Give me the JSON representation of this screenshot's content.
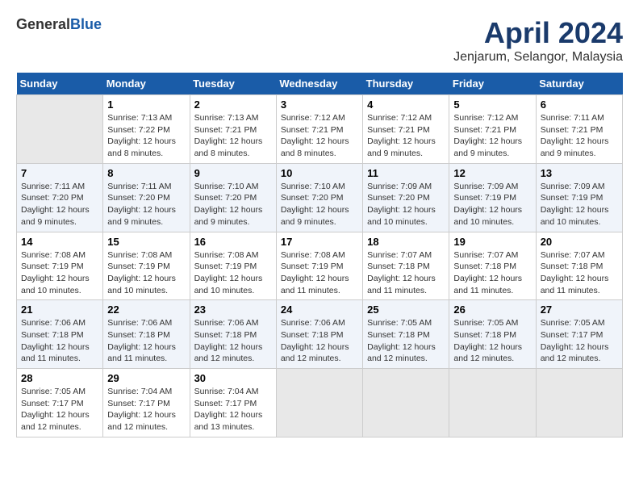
{
  "header": {
    "logo_general": "General",
    "logo_blue": "Blue",
    "title": "April 2024",
    "subtitle": "Jenjarum, Selangor, Malaysia"
  },
  "weekdays": [
    "Sunday",
    "Monday",
    "Tuesday",
    "Wednesday",
    "Thursday",
    "Friday",
    "Saturday"
  ],
  "weeks": [
    [
      {
        "day": "",
        "info": ""
      },
      {
        "day": "1",
        "info": "Sunrise: 7:13 AM\nSunset: 7:22 PM\nDaylight: 12 hours\nand 8 minutes."
      },
      {
        "day": "2",
        "info": "Sunrise: 7:13 AM\nSunset: 7:21 PM\nDaylight: 12 hours\nand 8 minutes."
      },
      {
        "day": "3",
        "info": "Sunrise: 7:12 AM\nSunset: 7:21 PM\nDaylight: 12 hours\nand 8 minutes."
      },
      {
        "day": "4",
        "info": "Sunrise: 7:12 AM\nSunset: 7:21 PM\nDaylight: 12 hours\nand 9 minutes."
      },
      {
        "day": "5",
        "info": "Sunrise: 7:12 AM\nSunset: 7:21 PM\nDaylight: 12 hours\nand 9 minutes."
      },
      {
        "day": "6",
        "info": "Sunrise: 7:11 AM\nSunset: 7:21 PM\nDaylight: 12 hours\nand 9 minutes."
      }
    ],
    [
      {
        "day": "7",
        "info": "Sunrise: 7:11 AM\nSunset: 7:20 PM\nDaylight: 12 hours\nand 9 minutes."
      },
      {
        "day": "8",
        "info": "Sunrise: 7:11 AM\nSunset: 7:20 PM\nDaylight: 12 hours\nand 9 minutes."
      },
      {
        "day": "9",
        "info": "Sunrise: 7:10 AM\nSunset: 7:20 PM\nDaylight: 12 hours\nand 9 minutes."
      },
      {
        "day": "10",
        "info": "Sunrise: 7:10 AM\nSunset: 7:20 PM\nDaylight: 12 hours\nand 9 minutes."
      },
      {
        "day": "11",
        "info": "Sunrise: 7:09 AM\nSunset: 7:20 PM\nDaylight: 12 hours\nand 10 minutes."
      },
      {
        "day": "12",
        "info": "Sunrise: 7:09 AM\nSunset: 7:19 PM\nDaylight: 12 hours\nand 10 minutes."
      },
      {
        "day": "13",
        "info": "Sunrise: 7:09 AM\nSunset: 7:19 PM\nDaylight: 12 hours\nand 10 minutes."
      }
    ],
    [
      {
        "day": "14",
        "info": "Sunrise: 7:08 AM\nSunset: 7:19 PM\nDaylight: 12 hours\nand 10 minutes."
      },
      {
        "day": "15",
        "info": "Sunrise: 7:08 AM\nSunset: 7:19 PM\nDaylight: 12 hours\nand 10 minutes."
      },
      {
        "day": "16",
        "info": "Sunrise: 7:08 AM\nSunset: 7:19 PM\nDaylight: 12 hours\nand 10 minutes."
      },
      {
        "day": "17",
        "info": "Sunrise: 7:08 AM\nSunset: 7:19 PM\nDaylight: 12 hours\nand 11 minutes."
      },
      {
        "day": "18",
        "info": "Sunrise: 7:07 AM\nSunset: 7:18 PM\nDaylight: 12 hours\nand 11 minutes."
      },
      {
        "day": "19",
        "info": "Sunrise: 7:07 AM\nSunset: 7:18 PM\nDaylight: 12 hours\nand 11 minutes."
      },
      {
        "day": "20",
        "info": "Sunrise: 7:07 AM\nSunset: 7:18 PM\nDaylight: 12 hours\nand 11 minutes."
      }
    ],
    [
      {
        "day": "21",
        "info": "Sunrise: 7:06 AM\nSunset: 7:18 PM\nDaylight: 12 hours\nand 11 minutes."
      },
      {
        "day": "22",
        "info": "Sunrise: 7:06 AM\nSunset: 7:18 PM\nDaylight: 12 hours\nand 11 minutes."
      },
      {
        "day": "23",
        "info": "Sunrise: 7:06 AM\nSunset: 7:18 PM\nDaylight: 12 hours\nand 12 minutes."
      },
      {
        "day": "24",
        "info": "Sunrise: 7:06 AM\nSunset: 7:18 PM\nDaylight: 12 hours\nand 12 minutes."
      },
      {
        "day": "25",
        "info": "Sunrise: 7:05 AM\nSunset: 7:18 PM\nDaylight: 12 hours\nand 12 minutes."
      },
      {
        "day": "26",
        "info": "Sunrise: 7:05 AM\nSunset: 7:18 PM\nDaylight: 12 hours\nand 12 minutes."
      },
      {
        "day": "27",
        "info": "Sunrise: 7:05 AM\nSunset: 7:17 PM\nDaylight: 12 hours\nand 12 minutes."
      }
    ],
    [
      {
        "day": "28",
        "info": "Sunrise: 7:05 AM\nSunset: 7:17 PM\nDaylight: 12 hours\nand 12 minutes."
      },
      {
        "day": "29",
        "info": "Sunrise: 7:04 AM\nSunset: 7:17 PM\nDaylight: 12 hours\nand 12 minutes."
      },
      {
        "day": "30",
        "info": "Sunrise: 7:04 AM\nSunset: 7:17 PM\nDaylight: 12 hours\nand 13 minutes."
      },
      {
        "day": "",
        "info": ""
      },
      {
        "day": "",
        "info": ""
      },
      {
        "day": "",
        "info": ""
      },
      {
        "day": "",
        "info": ""
      }
    ]
  ]
}
